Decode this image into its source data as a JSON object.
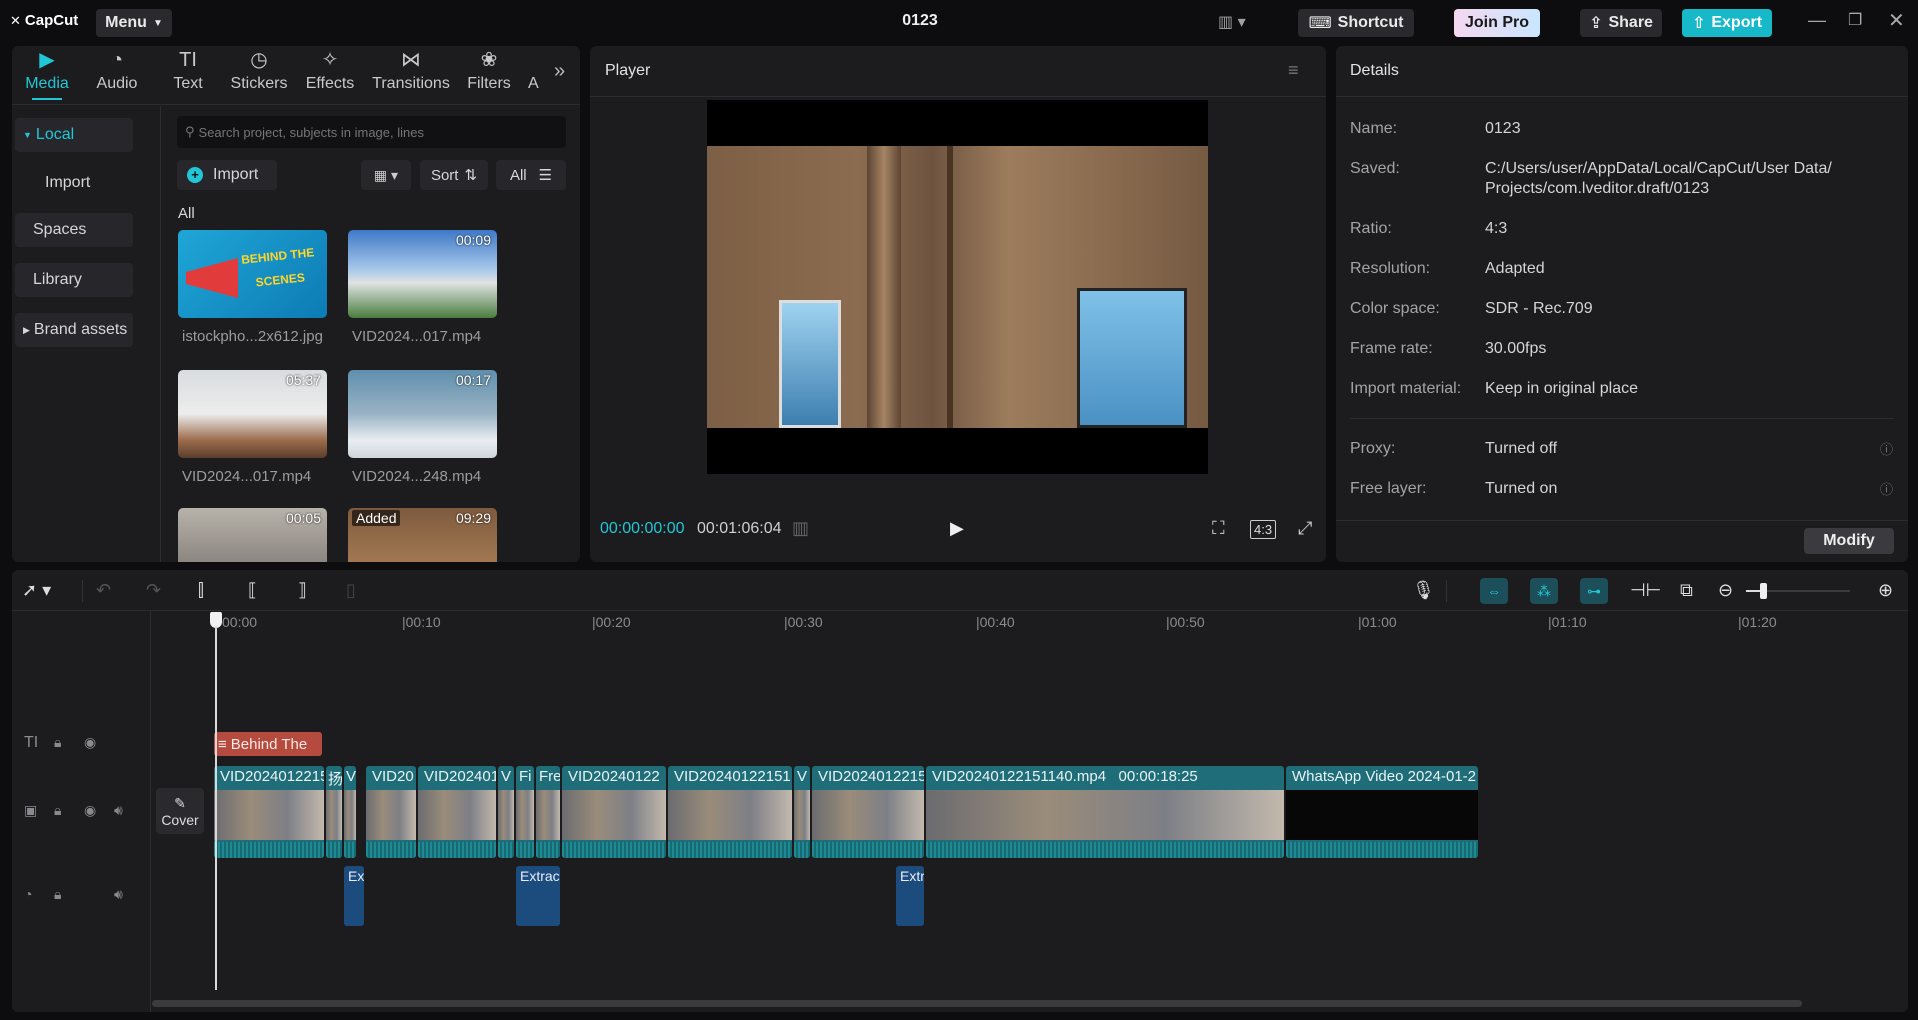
{
  "app": {
    "logo": "CapCut",
    "menu": "Menu",
    "project_title": "0123"
  },
  "titlebar": {
    "shortcut": "Shortcut",
    "join_pro": "Join Pro",
    "share": "Share",
    "export": "Export"
  },
  "tabs": [
    {
      "label": "Media",
      "icon": "media-icon",
      "glyph": "▶"
    },
    {
      "label": "Audio",
      "icon": "audio-icon",
      "glyph": "◔"
    },
    {
      "label": "Text",
      "icon": "text-icon",
      "glyph": "TI"
    },
    {
      "label": "Stickers",
      "icon": "sticker-icon",
      "glyph": "◷"
    },
    {
      "label": "Effects",
      "icon": "effects-icon",
      "glyph": "✧"
    },
    {
      "label": "Transitions",
      "icon": "transition-icon",
      "glyph": "⋈"
    },
    {
      "label": "Filters",
      "icon": "filter-icon",
      "glyph": "❀"
    },
    {
      "label": "A",
      "icon": "adjust-icon",
      "glyph": ""
    }
  ],
  "media_sidebar": {
    "local": "Local",
    "import": "Import",
    "spaces": "Spaces",
    "library": "Library",
    "brand": "Brand assets"
  },
  "media": {
    "search_placeholder": "Search project, subjects in image, lines",
    "import_btn": "Import",
    "sort": "Sort",
    "all_filter": "All",
    "section": "All",
    "items": [
      {
        "name": "istockpho...2x612.jpg",
        "duration": "",
        "badge": ""
      },
      {
        "name": "VID2024...017.mp4",
        "duration": "00:09",
        "badge": ""
      },
      {
        "name": "VID2024...017.mp4",
        "duration": "05:37",
        "badge": ""
      },
      {
        "name": "VID2024...248.mp4",
        "duration": "00:17",
        "badge": ""
      },
      {
        "name": "",
        "duration": "00:05",
        "badge": ""
      },
      {
        "name": "",
        "duration": "09:29",
        "badge": "Added"
      }
    ],
    "thumb_text": "BEHIND THE SCENES"
  },
  "player": {
    "title": "Player",
    "current_time": "00:00:00:00",
    "total_time": "00:01:06:04",
    "ratio": "4:3"
  },
  "details": {
    "title": "Details",
    "rows": [
      {
        "label": "Name:",
        "value": "0123"
      },
      {
        "label": "Saved:",
        "value": "C:/Users/user/AppData/Local/CapCut/User Data/",
        "value2": "Projects/com.lveditor.draft/0123"
      },
      {
        "label": "Ratio:",
        "value": "4:3"
      },
      {
        "label": "Resolution:",
        "value": "Adapted"
      },
      {
        "label": "Color space:",
        "value": "SDR - Rec.709"
      },
      {
        "label": "Frame rate:",
        "value": "30.00fps"
      },
      {
        "label": "Import material:",
        "value": "Keep in original place"
      },
      {
        "label": "Proxy:",
        "value": "Turned off"
      },
      {
        "label": "Free layer:",
        "value": "Turned on"
      }
    ],
    "modify": "Modify"
  },
  "timeline": {
    "ruler": [
      "00:00",
      "|00:10",
      "|00:20",
      "|00:30",
      "|00:40",
      "|00:50",
      "|01:00",
      "|01:10",
      "|01:20"
    ],
    "text_clip": "Behind The",
    "cover": "Cover",
    "video_clips": [
      "VID2024012215",
      "扬",
      "V",
      "VID20",
      "VID202401",
      "V",
      "Fi",
      "Fre",
      "VID20240122",
      "VID20240122151",
      "V",
      "VID2024012215",
      "VID20240122151140.mp4   00:00:18:25",
      "WhatsApp Video 2024-01-2"
    ],
    "audio_clips": [
      "Ex",
      "Extract",
      "Extr"
    ]
  },
  "colors": {
    "accent": "#21c7d6",
    "clip": "#1e6d78",
    "audio": "#1c4c7d",
    "text_clip": "#b44b3e"
  }
}
